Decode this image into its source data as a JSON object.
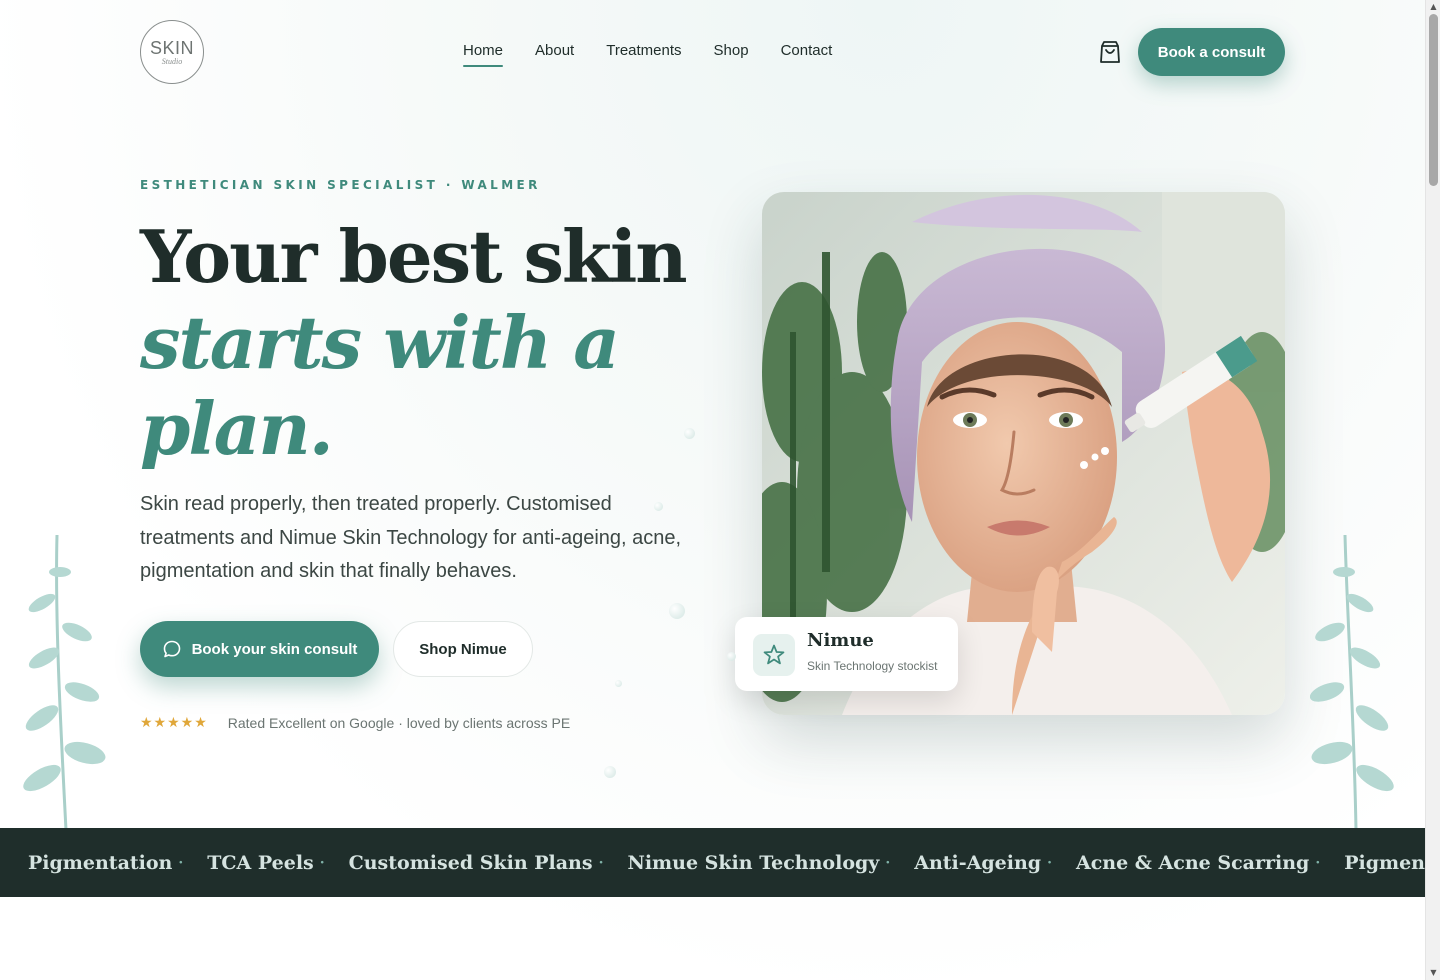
{
  "brand": {
    "logo_main": "SKIN",
    "logo_sub": "Studio"
  },
  "nav": {
    "items": [
      {
        "label": "Home",
        "active": true
      },
      {
        "label": "About",
        "active": false
      },
      {
        "label": "Treatments",
        "active": false
      },
      {
        "label": "Shop",
        "active": false
      },
      {
        "label": "Contact",
        "active": false
      }
    ]
  },
  "header": {
    "cart_icon": "shopping-bag-icon",
    "cta_label": "Book a consult"
  },
  "hero": {
    "eyebrow": "ESTHETICIAN SKIN SPECIALIST · WALMER",
    "headline_line1": "Your best skin",
    "headline_accent": "starts with a plan.",
    "lead": "Skin read properly, then treated properly. Customised treatments and Nimue Skin Technology for anti-ageing, acne, pigmentation and skin that finally behaves.",
    "primary_cta": "Book your skin consult",
    "primary_cta_icon": "chat-bubble-icon",
    "secondary_cta": "Shop Nimue",
    "stars": "★★★★★",
    "rating_text": "Rated Excellent on Google · loved by clients across PE"
  },
  "badge": {
    "icon": "star-icon",
    "title": "Nimue",
    "subtitle": "Skin Technology stockist"
  },
  "marquee": {
    "items": [
      "Pigmentation",
      "TCA Peels",
      "Customised Skin Plans",
      "Nimue Skin Technology",
      "Anti-Ageing",
      "Acne & Acne Scarring",
      "Pigmentation"
    ]
  },
  "colors": {
    "accent": "#3f8a7c",
    "dark": "#1f2e2b",
    "star": "#e0a73a"
  }
}
